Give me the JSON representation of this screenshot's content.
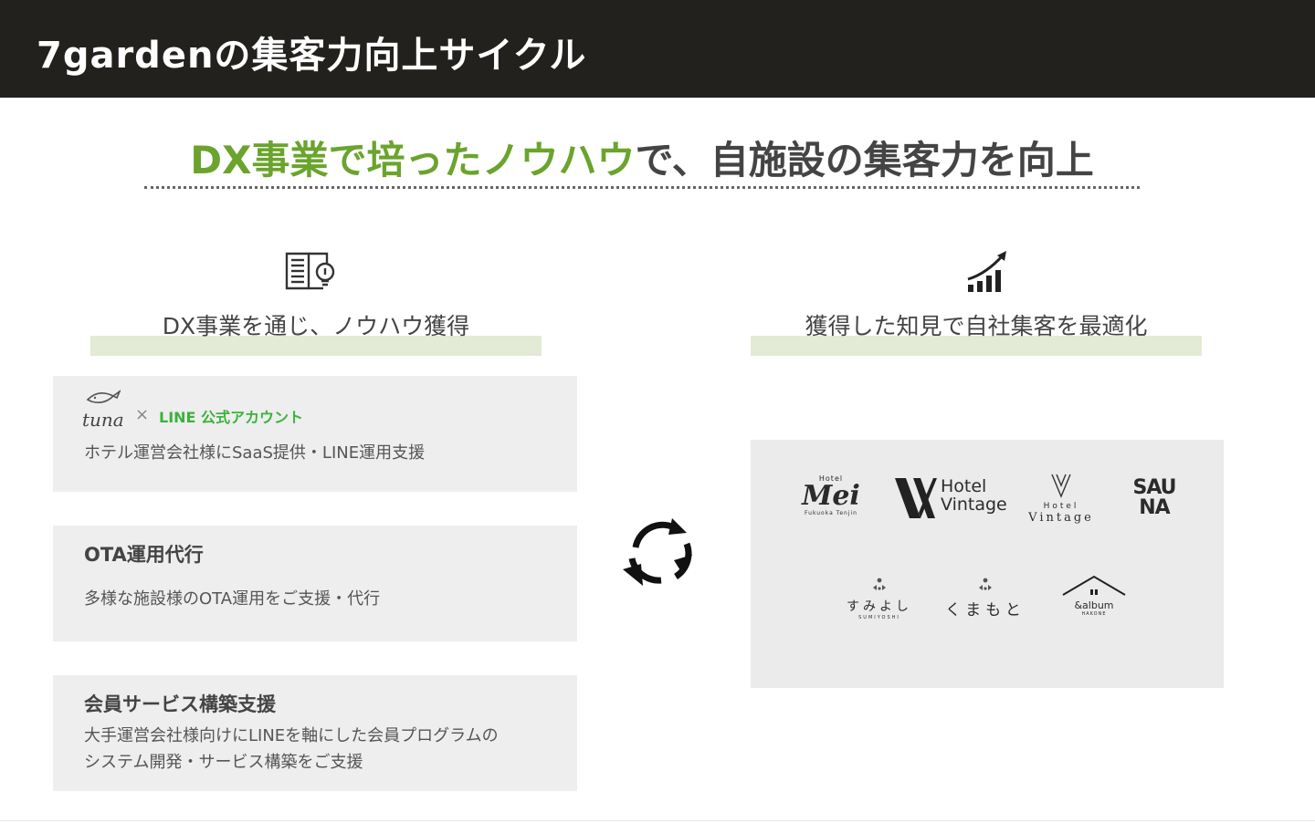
{
  "header": {
    "title": "7gardenの集客力向上サイクル"
  },
  "headline": {
    "highlight": "DX事業で培ったノウハウ",
    "rest": "で、自施設の集客力を向上",
    "highlight_color": "#6aa42d"
  },
  "left": {
    "heading": "DX事業を通じ、ノウハウ獲得",
    "icon": "book-lightbulb-icon",
    "cards": [
      {
        "logo_tuna": "tuna",
        "times": "×",
        "logo_line": "LINE 公式アカウント",
        "desc": "ホテル運営会社様にSaaS提供・LINE運用支援"
      },
      {
        "title": "OTA運用代行",
        "desc": "多様な施設様のOTA運用をご支援・代行"
      },
      {
        "title": "会員サービス構築支援",
        "desc1": "大手運営会社様向けにLINEを軸にした会員プログラムの",
        "desc2": "システム開発・サービス構築をご支援"
      }
    ]
  },
  "right": {
    "heading": "獲得した知見で自社集客を最適化",
    "icon": "growth-chart-icon",
    "logos": {
      "mei_small": "Hotel",
      "mei": "Mei",
      "mei_sub": "Fukuoka Tenjin",
      "vintage1_a": "Hotel",
      "vintage1_b": "Vintage",
      "vintage2_a": "Hotel",
      "vintage2_b": "Vintage",
      "sauna": "SAUNA",
      "sumiyoshi": "すみよし",
      "sumiyoshi_sub": "SUMIYOSHI",
      "kumamoto": "くまもと",
      "album": "&album",
      "album_sub": "HAKONE"
    }
  },
  "cycle_icon": "refresh-cycle-icon"
}
